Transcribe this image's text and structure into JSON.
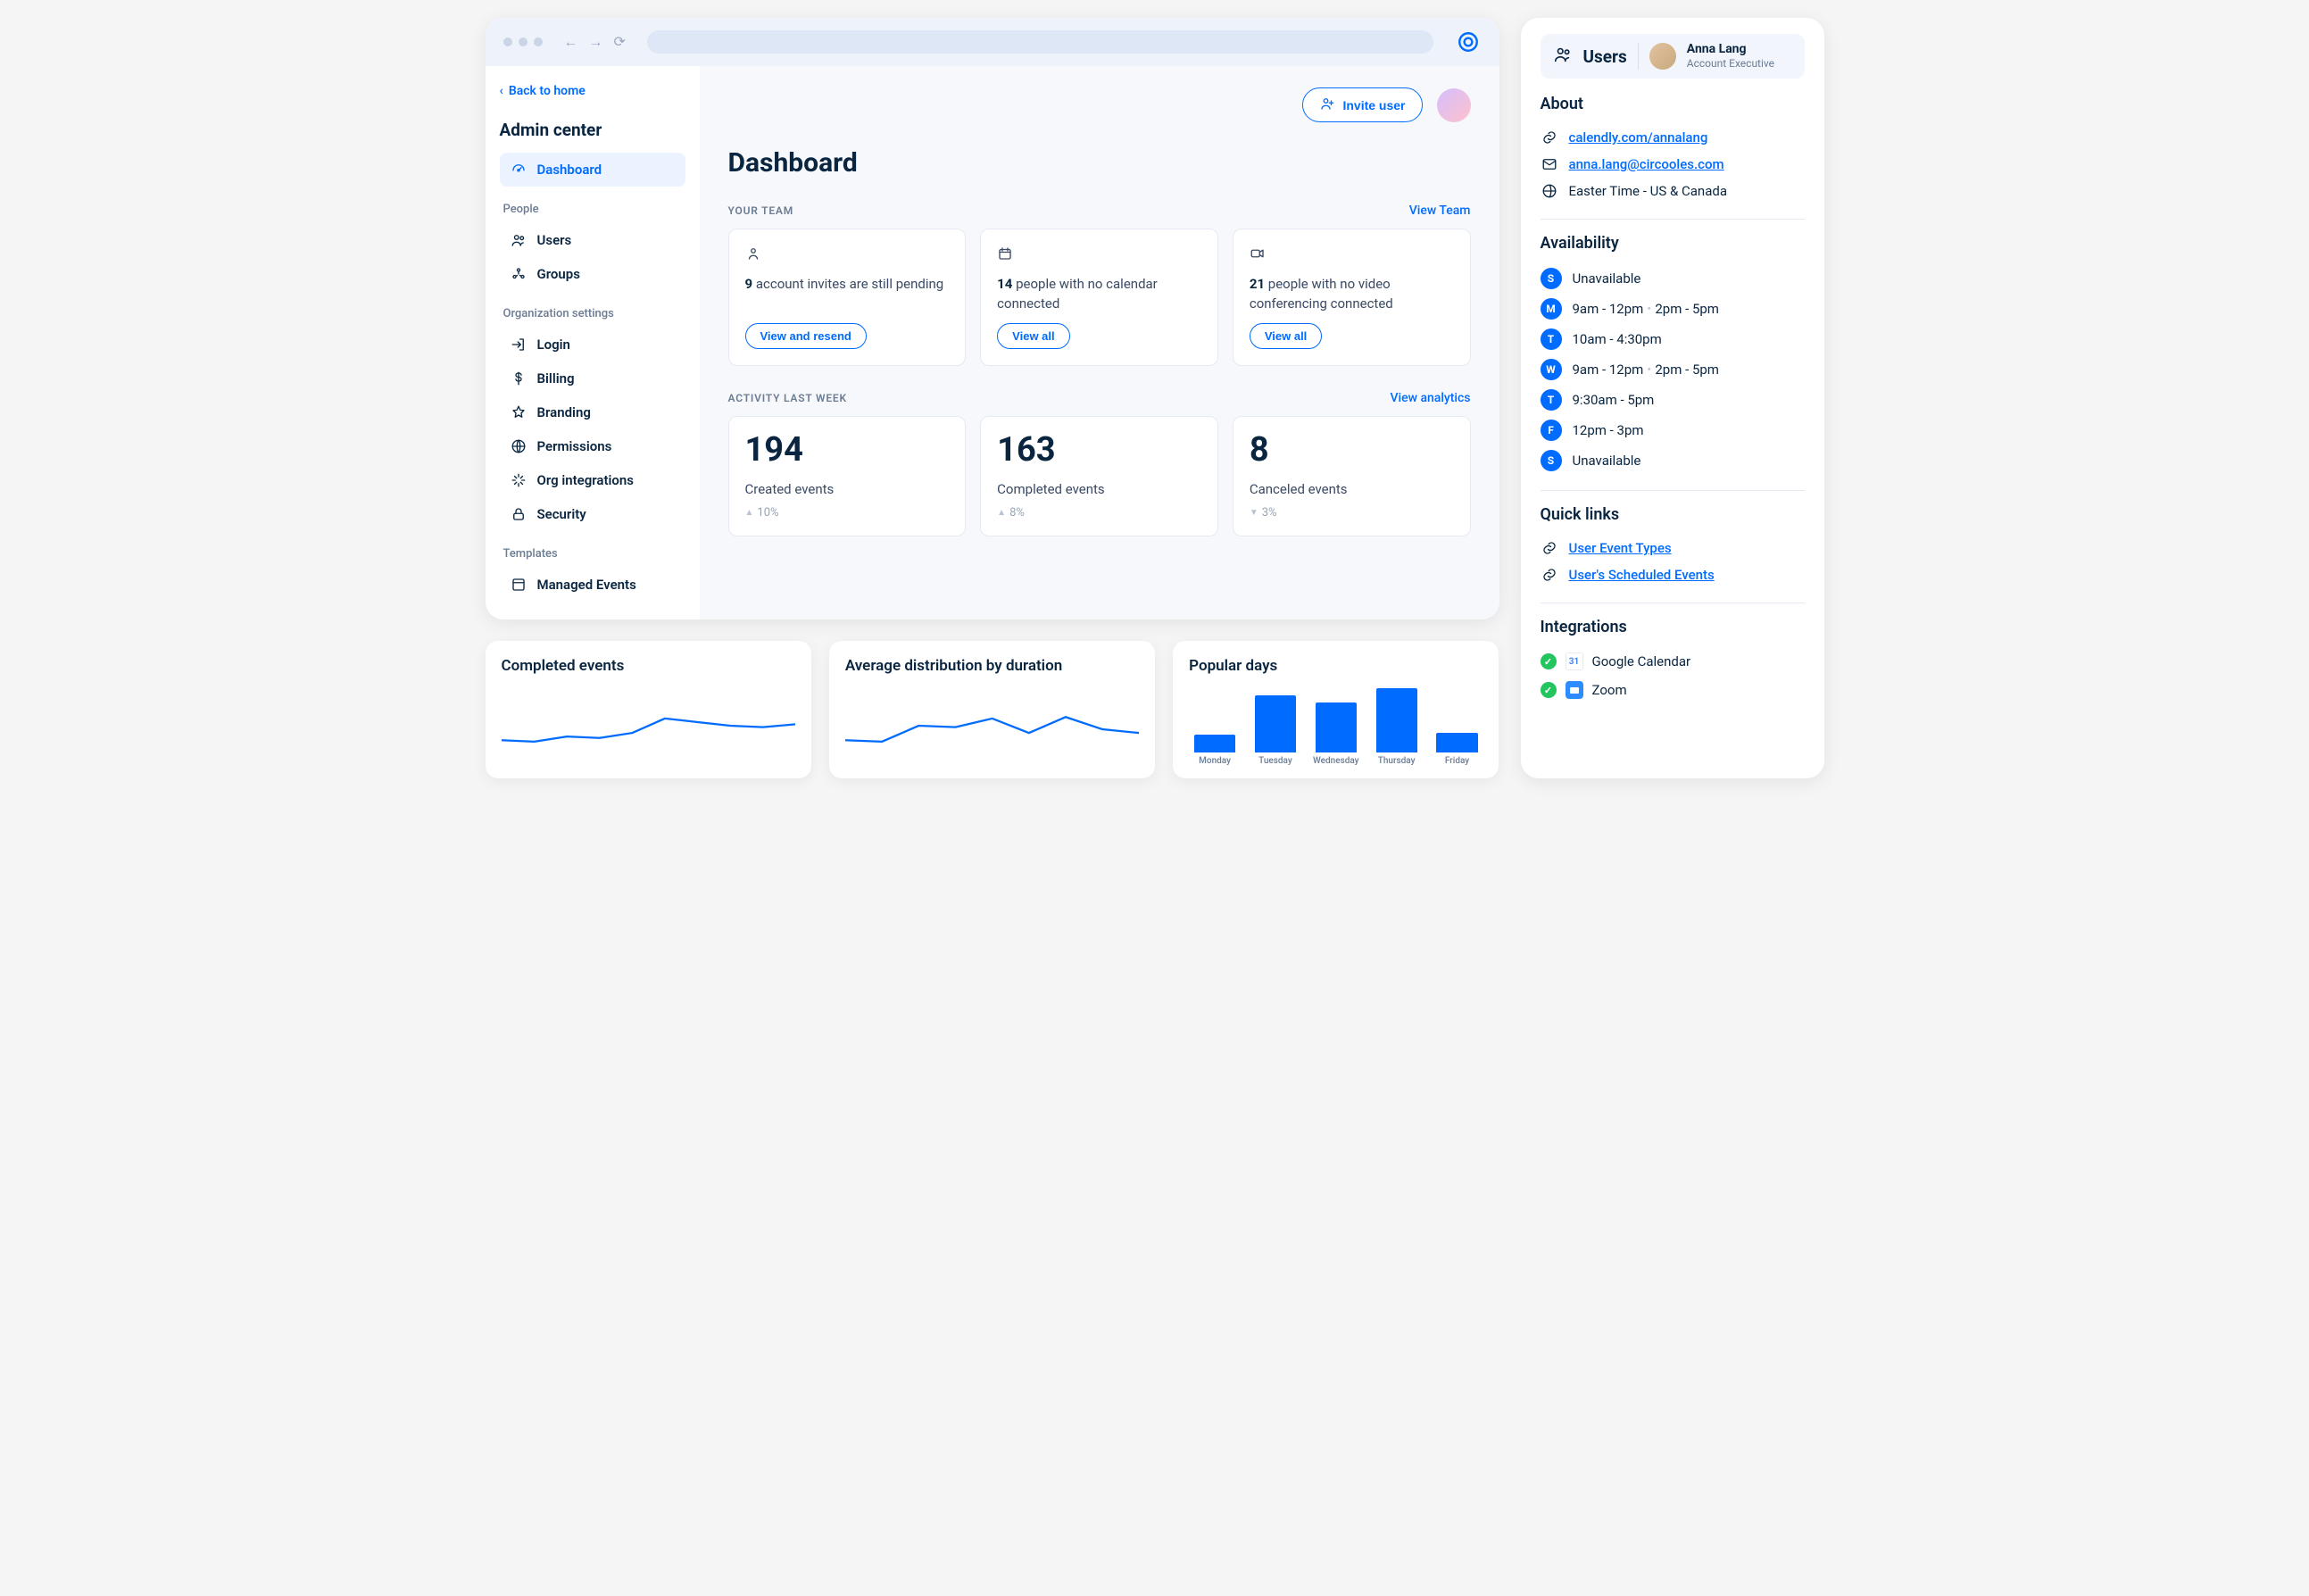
{
  "sidebar": {
    "back_label": "Back to home",
    "title": "Admin center",
    "dashboard": "Dashboard",
    "section_people": "People",
    "users": "Users",
    "groups": "Groups",
    "section_org": "Organization settings",
    "login": "Login",
    "billing": "Billing",
    "branding": "Branding",
    "permissions": "Permissions",
    "org_integrations": "Org integrations",
    "security": "Security",
    "section_templates": "Templates",
    "managed_events": "Managed Events"
  },
  "header": {
    "invite_label": "Invite user"
  },
  "main": {
    "title": "Dashboard",
    "team_section_label": "YOUR TEAM",
    "team_section_link": "View Team",
    "team_cards": [
      {
        "count": "9",
        "text": "account invites are still pending",
        "button": "View and resend"
      },
      {
        "count": "14",
        "text": "people with no calendar connected",
        "button": "View all"
      },
      {
        "count": "21",
        "text": "people with no video conferencing connected",
        "button": "View all"
      }
    ],
    "activity_section_label": "ACTIVITY LAST WEEK",
    "activity_section_link": "View analytics",
    "activity_cards": [
      {
        "value": "194",
        "label": "Created events",
        "trend": "10%",
        "dir": "up"
      },
      {
        "value": "163",
        "label": "Completed events",
        "trend": "8%",
        "dir": "up"
      },
      {
        "value": "8",
        "label": "Canceled events",
        "trend": "3%",
        "dir": "down"
      }
    ]
  },
  "charts": {
    "completed_title": "Completed events",
    "distribution_title": "Average distribution by duration",
    "popular_title": "Popular days"
  },
  "chart_data": [
    {
      "type": "line",
      "title": "Completed events",
      "x": [
        0,
        1,
        2,
        3,
        4,
        5,
        6,
        7,
        8,
        9
      ],
      "values": [
        30,
        28,
        35,
        33,
        40,
        60,
        55,
        50,
        48,
        52
      ],
      "ylim": [
        0,
        100
      ]
    },
    {
      "type": "line",
      "title": "Average distribution by duration",
      "x": [
        0,
        1,
        2,
        3,
        4,
        5,
        6,
        7,
        8
      ],
      "values": [
        30,
        28,
        50,
        48,
        60,
        40,
        62,
        45,
        40
      ],
      "ylim": [
        0,
        100
      ]
    },
    {
      "type": "bar",
      "title": "Popular days",
      "categories": [
        "Monday",
        "Tuesday",
        "Wednesday",
        "Thursday",
        "Friday"
      ],
      "values": [
        25,
        80,
        70,
        90,
        28
      ],
      "ylim": [
        0,
        100
      ]
    }
  ],
  "user_panel": {
    "header_title": "Users",
    "name": "Anna Lang",
    "role": "Account Executive",
    "about_title": "About",
    "url": "calendly.com/annalang",
    "email": "anna.lang@circooles.com",
    "timezone": "Easter Time - US & Canada",
    "availability_title": "Availability",
    "availability": [
      {
        "day": "S",
        "slots": [
          "Unavailable"
        ]
      },
      {
        "day": "M",
        "slots": [
          "9am - 12pm",
          "2pm - 5pm"
        ]
      },
      {
        "day": "T",
        "slots": [
          "10am - 4:30pm"
        ]
      },
      {
        "day": "W",
        "slots": [
          "9am - 12pm",
          "2pm - 5pm"
        ]
      },
      {
        "day": "T",
        "slots": [
          "9:30am - 5pm"
        ]
      },
      {
        "day": "F",
        "slots": [
          "12pm - 3pm"
        ]
      },
      {
        "day": "S",
        "slots": [
          "Unavailable"
        ]
      }
    ],
    "quick_links_title": "Quick links",
    "quick_links": [
      "User Event Types",
      "User's Scheduled Events"
    ],
    "integrations_title": "Integrations",
    "integrations": [
      "Google Calendar",
      "Zoom"
    ]
  }
}
